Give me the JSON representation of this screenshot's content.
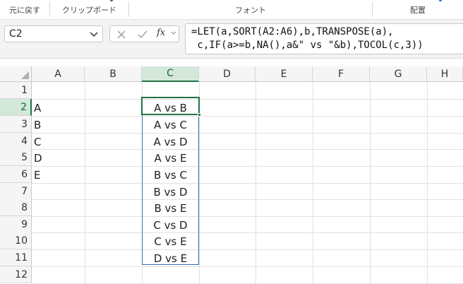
{
  "ribbon": {
    "groups": [
      {
        "label": "元に戻す"
      },
      {
        "label": "クリップボード"
      },
      {
        "label": "フォント"
      },
      {
        "label": "配置"
      }
    ]
  },
  "formula_bar": {
    "name_box": "C2",
    "fx_label": "fx",
    "formula_line1": "=LET(a,SORT(A2:A6),b,TRANSPOSE(a),",
    "formula_line2": " c,IF(a>=b,NA(),a&\" vs \"&b),TOCOL(c,3))"
  },
  "sheet": {
    "columns": [
      "A",
      "B",
      "C",
      "D",
      "E",
      "F",
      "G",
      "H"
    ],
    "active_column": "C",
    "rows": [
      "1",
      "2",
      "3",
      "4",
      "5",
      "6",
      "7",
      "8",
      "9",
      "10",
      "11",
      "12"
    ],
    "active_row": "2",
    "column_a_values": [
      "A",
      "B",
      "C",
      "D",
      "E"
    ],
    "column_c_values": [
      "A vs B",
      "A vs C",
      "A vs D",
      "A vs E",
      "B vs C",
      "B vs D",
      "B vs E",
      "C vs D",
      "C vs E",
      "D vs E"
    ]
  },
  "colors": {
    "accent_green": "#217346",
    "spill_border_blue": "#3a6bb7",
    "header_bg": "#f5f5f5",
    "active_header_bg": "#d3e7da"
  }
}
